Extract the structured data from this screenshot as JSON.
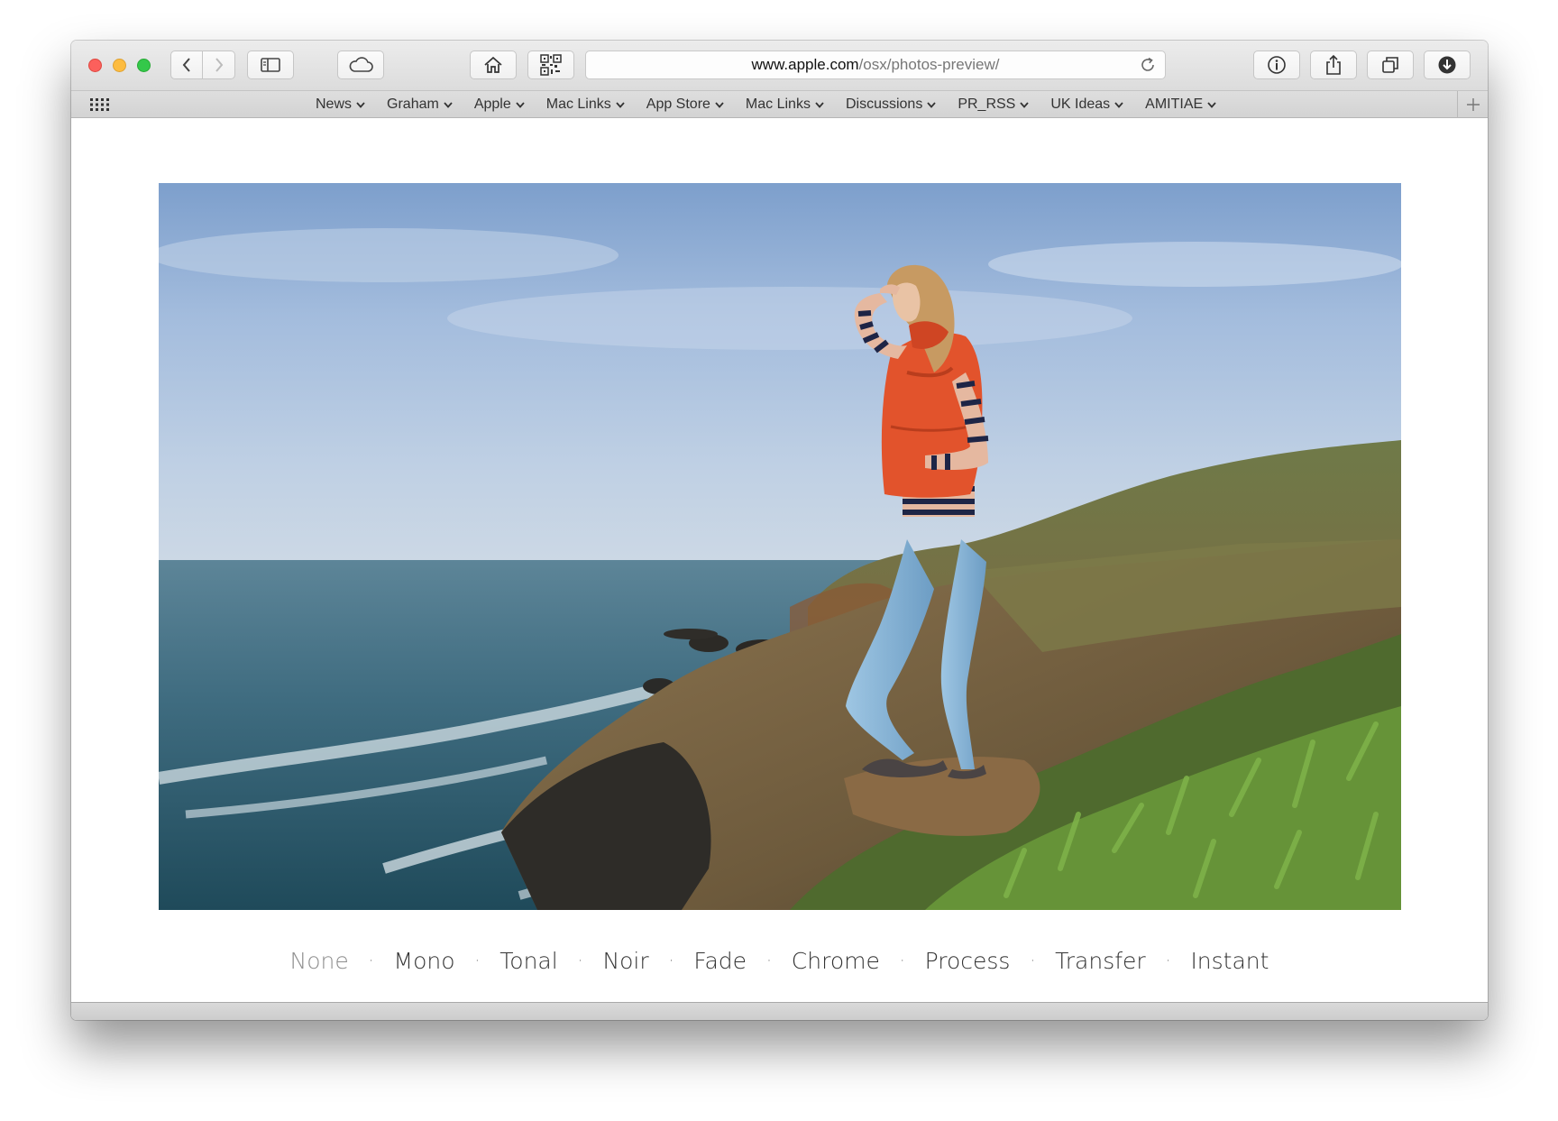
{
  "browser": {
    "url_host": "www.apple.com",
    "url_path": "/osx/photos-preview/"
  },
  "bookmarks": [
    {
      "label": "News"
    },
    {
      "label": "Graham"
    },
    {
      "label": "Apple"
    },
    {
      "label": "Mac Links"
    },
    {
      "label": "App Store"
    },
    {
      "label": "Mac Links"
    },
    {
      "label": "Discussions"
    },
    {
      "label": "PR_RSS"
    },
    {
      "label": "UK Ideas"
    },
    {
      "label": "AMITIAE"
    }
  ],
  "filters": [
    {
      "label": "None",
      "active": false
    },
    {
      "label": "Mono",
      "active": true
    },
    {
      "label": "Tonal",
      "active": true
    },
    {
      "label": "Noir",
      "active": true
    },
    {
      "label": "Fade",
      "active": true
    },
    {
      "label": "Chrome",
      "active": true
    },
    {
      "label": "Process",
      "active": true
    },
    {
      "label": "Transfer",
      "active": true
    },
    {
      "label": "Instant",
      "active": true
    }
  ],
  "filter_separator": "·",
  "colors": {
    "traffic_red": "#fc605c",
    "traffic_yellow": "#fdbc40",
    "traffic_green": "#34c84a",
    "vest": "#e2532c",
    "jeans": "#8db8d8",
    "sky": "#a9c3e2",
    "ocean": "#3f6f82"
  }
}
